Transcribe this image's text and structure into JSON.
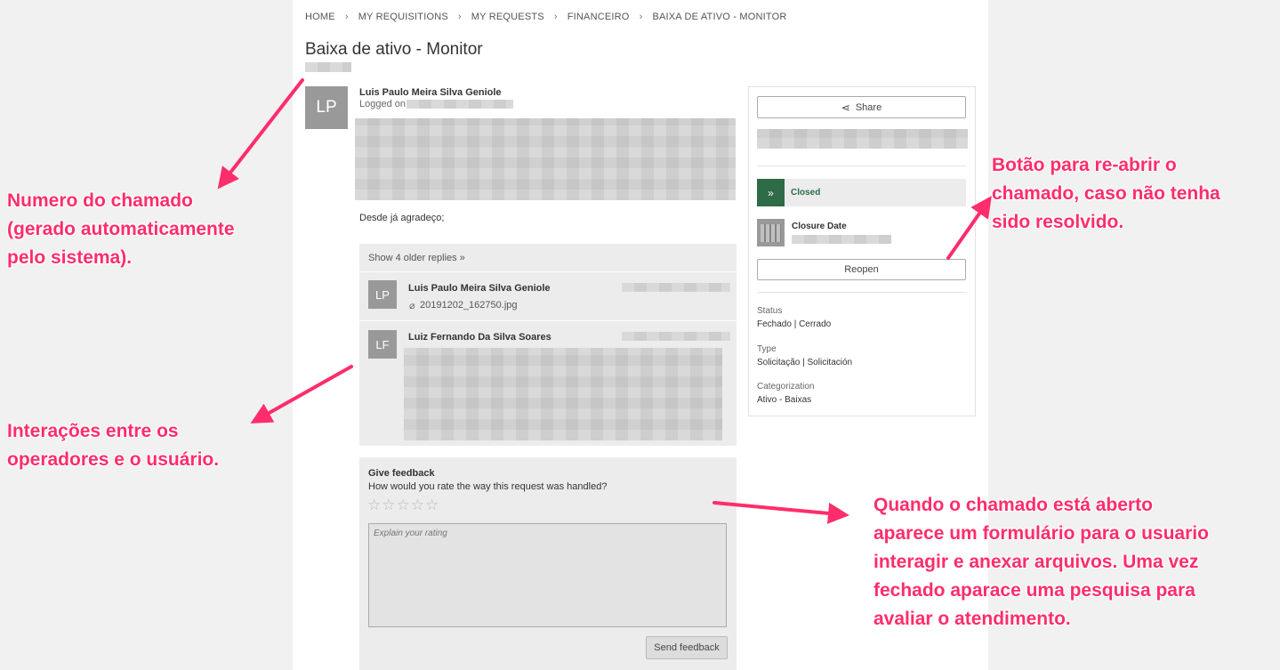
{
  "breadcrumb": [
    "HOME",
    "MY REQUISITIONS",
    "MY REQUESTS",
    "FINANCEIRO",
    "BAIXA DE ATIVO - MONITOR"
  ],
  "page_title": "Baixa de ativo - Monitor",
  "request": {
    "author_initials": "LP",
    "author": "Luis Paulo Meira Silva Geniole",
    "logged_on_label": "Logged on",
    "closing_line": "Desde já agradeço;"
  },
  "replies": {
    "show_older": "Show 4 older replies »",
    "items": [
      {
        "initials": "LP",
        "name": "Luis Paulo Meira Silva Geniole",
        "attachment": "20191202_162750.jpg"
      },
      {
        "initials": "LF",
        "name": "Luiz Fernando Da Silva Soares"
      }
    ]
  },
  "feedback": {
    "title": "Give feedback",
    "question": "How would you rate the way this request was handled?",
    "placeholder": "Explain your rating",
    "send_label": "Send feedback",
    "stars": 0
  },
  "sidebar": {
    "share_label": "Share",
    "status_badge": "Closed",
    "closure_date_label": "Closure Date",
    "reopen_label": "Reopen",
    "fields": [
      {
        "label": "Status",
        "value": "Fechado | Cerrado"
      },
      {
        "label": "Type",
        "value": "Solicitação | Solicitación"
      },
      {
        "label": "Categorization",
        "value": "Ativo - Baixas"
      }
    ]
  },
  "annotations": {
    "ticket_number": [
      "Numero do chamado",
      "(gerado automaticamente",
      "pelo sistema)."
    ],
    "interactions": [
      "Interações entre os",
      "operadores e o usuário."
    ],
    "reopen": [
      "Botão para re-abrir o",
      "chamado, caso não tenha",
      "sido resolvido."
    ],
    "form": [
      "Quando o chamado está aberto",
      "aparece um formulário para o usuario",
      "interagir e anexar arquivos. Uma vez",
      "fechado aparace uma pesquisa para",
      "avaliar o atendimento."
    ]
  },
  "colors": {
    "accent_pink": "#ff2d6b",
    "closed_green": "#2e6b47"
  }
}
